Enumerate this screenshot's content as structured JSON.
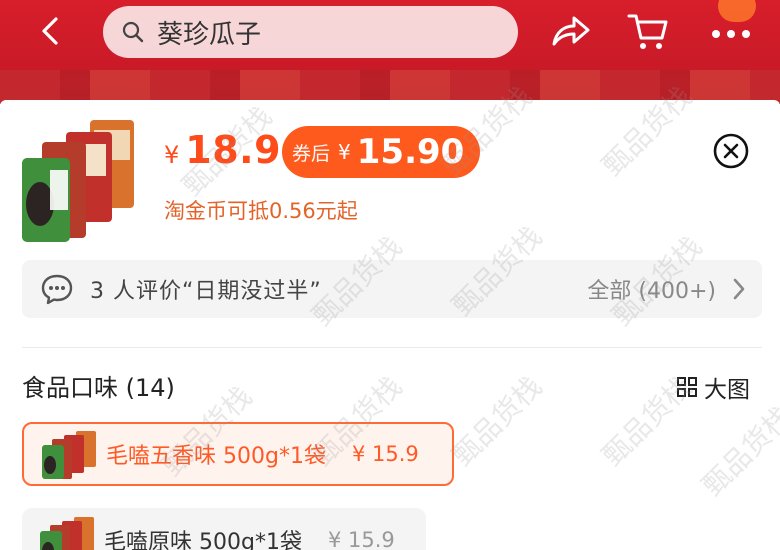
{
  "search": {
    "query": "葵珍瓜子"
  },
  "product": {
    "price_symbol": "¥",
    "price": "18.9",
    "coupon_label": "券后",
    "coupon_symbol": "¥",
    "coupon_price": "15.90",
    "coin_note": "淘金币可抵0.56元起"
  },
  "reviews": {
    "text": "3 人评价“日期没过半”",
    "all_label": "全部 (400+)"
  },
  "flavors": {
    "title": "食品口味 (14)",
    "big_view_label": "大图",
    "options": [
      {
        "name": "毛嗑五香味 500g*1袋",
        "price": "¥ 15.9",
        "selected": true
      },
      {
        "name": "毛嗑原味 500g*1袋",
        "price": "¥ 15.9",
        "selected": false
      }
    ]
  },
  "watermark": "甄品货栈",
  "colors": {
    "brand_red": "#d81e2b",
    "accent_orange": "#ff5a1e",
    "coin_orange": "#e2642a"
  },
  "icons": [
    "back-icon",
    "search-icon",
    "share-icon",
    "cart-icon",
    "more-icon",
    "close-icon",
    "chat-icon",
    "chevron-right-icon",
    "grid-icon"
  ]
}
